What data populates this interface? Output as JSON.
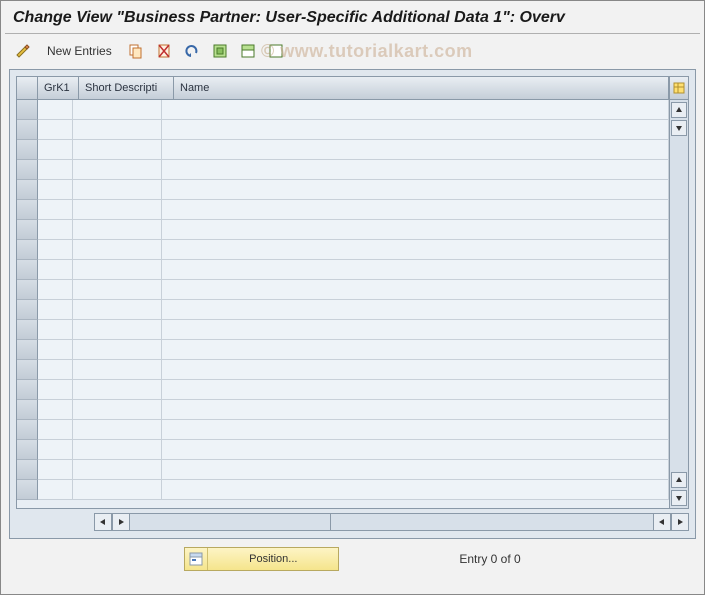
{
  "title": "Change View \"Business Partner: User-Specific Additional Data 1\": Overv",
  "toolbar": {
    "new_entries": "New Entries"
  },
  "table": {
    "headers": {
      "c1": "GrK1",
      "c2": "Short Descripti",
      "c3": "Name"
    },
    "rows": 20
  },
  "footer": {
    "position_label": "Position...",
    "entry_text": "Entry 0 of 0"
  },
  "watermark": {
    "prefix": "©",
    "text": " www.tutorialkart.com"
  }
}
